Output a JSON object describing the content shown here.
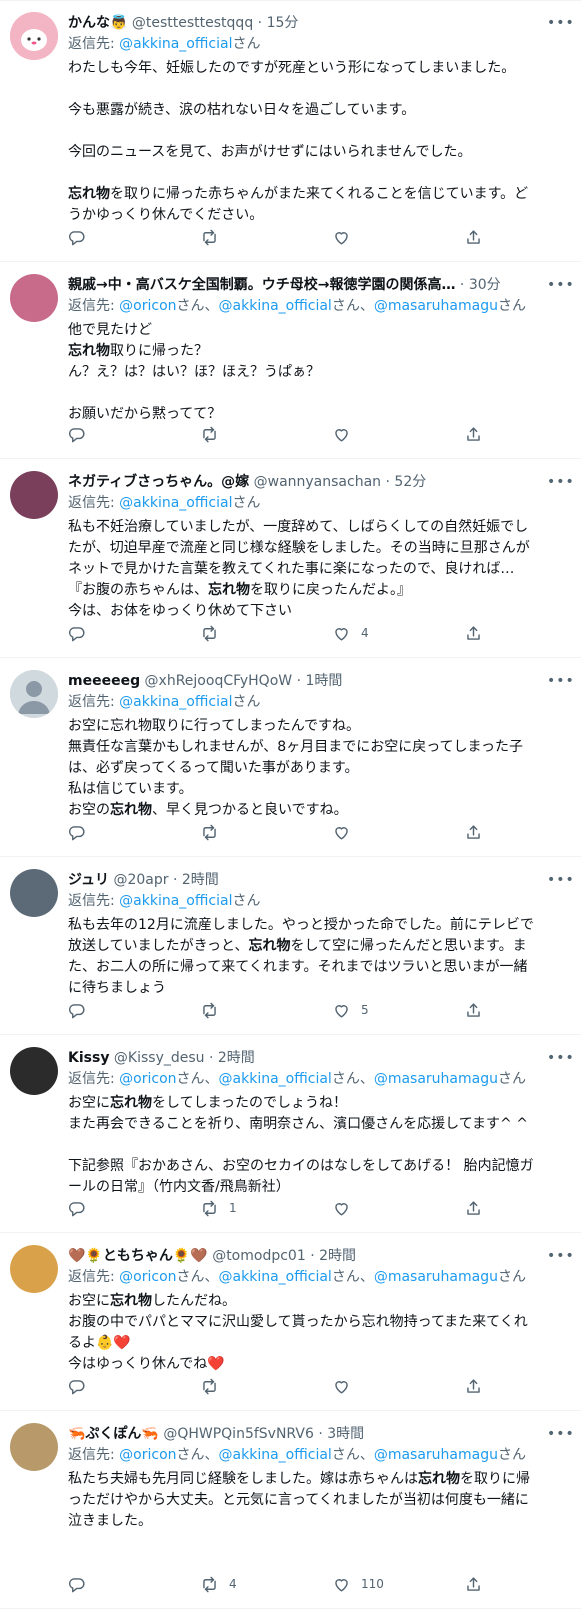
{
  "reply_prefix": "返信先: ",
  "honorific": "さん",
  "comma": "、",
  "sep": "·",
  "more_glyph": "•••",
  "tweets": [
    {
      "name": "かんな👼",
      "handle": "@testtesttestqqq",
      "time": "15分",
      "reply_to": [
        "@akkina_official"
      ],
      "body": [
        "わたしも今年、妊娠したのですが死産という形になってしまいました。",
        "",
        "今も悪露が続き、涙の枯れない日々を過ごしています。",
        "",
        "今回のニュースを見て、お声がけせずにはいられませんでした。",
        "",
        "**忘れ物**を取りに帰った赤ちゃんがまた来てくれることを信じています。ど",
        "うかゆっくり休んでください。"
      ],
      "stats": {
        "reply": "",
        "retweet": "",
        "like": ""
      },
      "avatar_color": "#f3b5c3"
    },
    {
      "name": "親戚→中・高バスケ全国制覇。ウチ母校→報徳学園の関係高…",
      "handle": "",
      "time": "30分",
      "reply_to": [
        "@oricon",
        "@akkina_official",
        "@masaruhamagu"
      ],
      "body": [
        "他で見たけど",
        "**忘れ物**取りに帰った？",
        "ん？え？は？はい？ほ？ほえ？うぱぁ？",
        "",
        "お願いだから黙ってて？"
      ],
      "stats": {
        "reply": "",
        "retweet": "",
        "like": ""
      },
      "avatar_color": "#c86a8a"
    },
    {
      "name": "ネガティブさっちゃん。@嫁",
      "handle": "@wannyansachan",
      "time": "52分",
      "reply_to": [
        "@akkina_official"
      ],
      "body": [
        "私も不妊治療していましたが、一度辞めて、しばらくしての自然妊娠でし",
        "たが、切迫早産で流産と同じ様な経験をしました。その当時に旦那さんが",
        "ネットで見かけた言葉を教えてくれた事に楽になったので、良ければ…",
        "『お腹の赤ちゃんは、**忘れ物**を取りに戻ったんだよ。』",
        "今は、お体をゆっくり休めて下さい"
      ],
      "stats": {
        "reply": "",
        "retweet": "",
        "like": "4"
      },
      "avatar_color": "#7a3f5a"
    },
    {
      "name": "meeeeeg",
      "handle": "@xhRejooqCFyHQoW",
      "time": "1時間",
      "reply_to": [
        "@akkina_official"
      ],
      "body": [
        "お空に忘れ物取りに行ってしまったんですね。",
        "無責任な言葉かもしれませんが、8ヶ月目までにお空に戻ってしまった子",
        "は、必ず戻ってくるって聞いた事があります。",
        "私は信じています。",
        "お空の**忘れ物**、早く見つかると良いですね。"
      ],
      "stats": {
        "reply": "",
        "retweet": "",
        "like": ""
      },
      "avatar_color": "#cfd9de"
    },
    {
      "name": "ジュリ",
      "handle": "@20apr",
      "time": "2時間",
      "reply_to": [
        "@akkina_official"
      ],
      "body": [
        "私も去年の12月に流産しました。やっと授かった命でした。前にテレビで",
        "放送していましたがきっと、**忘れ物**をして空に帰ったんだと思います。ま",
        "た、お二人の所に帰って来てくれます。それまではツラいと思いまが一緒",
        "に待ちましょう"
      ],
      "stats": {
        "reply": "",
        "retweet": "",
        "like": "5"
      },
      "avatar_color": "#5c6a78"
    },
    {
      "name": "Kissy",
      "handle": "@Kissy_desu",
      "time": "2時間",
      "reply_to": [
        "@oricon",
        "@akkina_official",
        "@masaruhamagu"
      ],
      "body": [
        "お空に**忘れ物**をしてしまったのでしょうね！",
        "また再会できることを祈り、南明奈さん、濱口優さんを応援してます^ ^",
        "",
        "下記参照『おかあさん、お空のセカイのはなしをしてあげる！ 胎内記憶ガ",
        "ールの日常』（竹内文香/飛鳥新社）"
      ],
      "stats": {
        "reply": "",
        "retweet": "1",
        "like": ""
      },
      "avatar_color": "#2b2b2b"
    },
    {
      "name": "🤎🌻ともちゃん🌻🤎",
      "handle": "@tomodpc01",
      "time": "2時間",
      "reply_to": [
        "@oricon",
        "@akkina_official",
        "@masaruhamagu"
      ],
      "body": [
        "お空に**忘れ物**したんだね。",
        "お腹の中でパパとママに沢山愛して貰ったから忘れ物持ってまた来てくれ",
        "るよ👶❤️",
        "今はゆっくり休んでね❤️"
      ],
      "stats": {
        "reply": "",
        "retweet": "",
        "like": ""
      },
      "avatar_color": "#d9a24a"
    },
    {
      "name": "🦐ぷくぽん🦐",
      "handle": "@QHWPQin5fSvNRV6",
      "time": "3時間",
      "reply_to": [
        "@oricon",
        "@akkina_official",
        "@masaruhamagu"
      ],
      "body": [
        "私たち夫婦も先月同じ経験をしました。嫁は赤ちゃんは**忘れ物**を取りに帰",
        "っただけやから大丈夫。と元気に言ってくれましたが当初は何度も一緒に",
        "泣きました。"
      ],
      "stats": {
        "reply": "",
        "retweet": "4",
        "like": "110"
      },
      "avatar_color": "#b89a6a"
    }
  ]
}
